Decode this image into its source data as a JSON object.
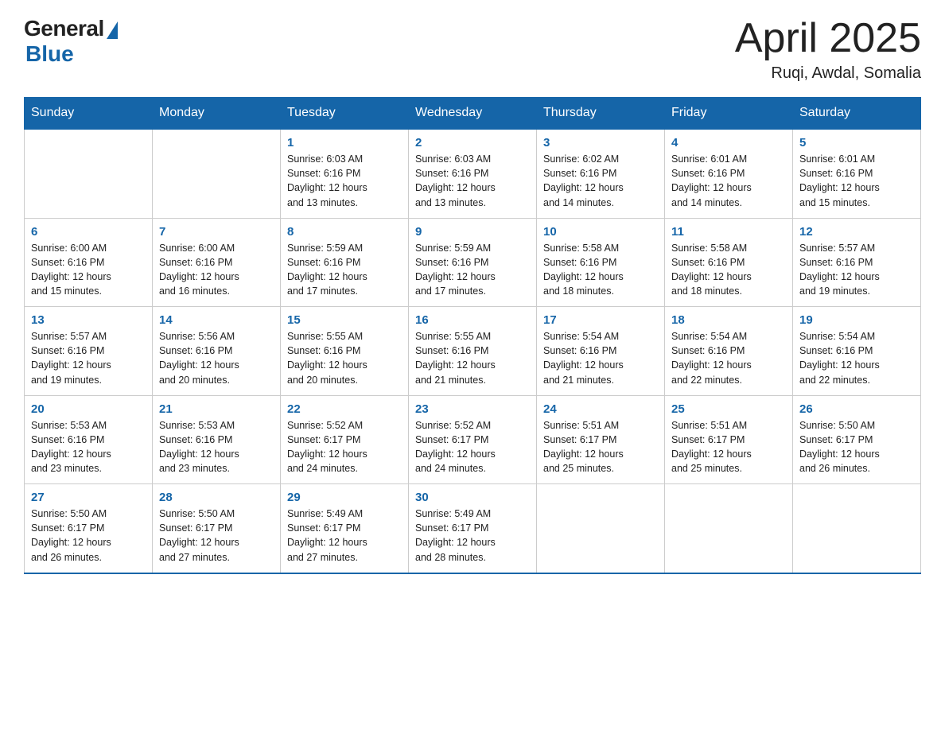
{
  "logo": {
    "general": "General",
    "blue": "Blue"
  },
  "title": "April 2025",
  "location": "Ruqi, Awdal, Somalia",
  "days_of_week": [
    "Sunday",
    "Monday",
    "Tuesday",
    "Wednesday",
    "Thursday",
    "Friday",
    "Saturday"
  ],
  "weeks": [
    [
      {
        "day": "",
        "info": ""
      },
      {
        "day": "",
        "info": ""
      },
      {
        "day": "1",
        "info": "Sunrise: 6:03 AM\nSunset: 6:16 PM\nDaylight: 12 hours\nand 13 minutes."
      },
      {
        "day": "2",
        "info": "Sunrise: 6:03 AM\nSunset: 6:16 PM\nDaylight: 12 hours\nand 13 minutes."
      },
      {
        "day": "3",
        "info": "Sunrise: 6:02 AM\nSunset: 6:16 PM\nDaylight: 12 hours\nand 14 minutes."
      },
      {
        "day": "4",
        "info": "Sunrise: 6:01 AM\nSunset: 6:16 PM\nDaylight: 12 hours\nand 14 minutes."
      },
      {
        "day": "5",
        "info": "Sunrise: 6:01 AM\nSunset: 6:16 PM\nDaylight: 12 hours\nand 15 minutes."
      }
    ],
    [
      {
        "day": "6",
        "info": "Sunrise: 6:00 AM\nSunset: 6:16 PM\nDaylight: 12 hours\nand 15 minutes."
      },
      {
        "day": "7",
        "info": "Sunrise: 6:00 AM\nSunset: 6:16 PM\nDaylight: 12 hours\nand 16 minutes."
      },
      {
        "day": "8",
        "info": "Sunrise: 5:59 AM\nSunset: 6:16 PM\nDaylight: 12 hours\nand 17 minutes."
      },
      {
        "day": "9",
        "info": "Sunrise: 5:59 AM\nSunset: 6:16 PM\nDaylight: 12 hours\nand 17 minutes."
      },
      {
        "day": "10",
        "info": "Sunrise: 5:58 AM\nSunset: 6:16 PM\nDaylight: 12 hours\nand 18 minutes."
      },
      {
        "day": "11",
        "info": "Sunrise: 5:58 AM\nSunset: 6:16 PM\nDaylight: 12 hours\nand 18 minutes."
      },
      {
        "day": "12",
        "info": "Sunrise: 5:57 AM\nSunset: 6:16 PM\nDaylight: 12 hours\nand 19 minutes."
      }
    ],
    [
      {
        "day": "13",
        "info": "Sunrise: 5:57 AM\nSunset: 6:16 PM\nDaylight: 12 hours\nand 19 minutes."
      },
      {
        "day": "14",
        "info": "Sunrise: 5:56 AM\nSunset: 6:16 PM\nDaylight: 12 hours\nand 20 minutes."
      },
      {
        "day": "15",
        "info": "Sunrise: 5:55 AM\nSunset: 6:16 PM\nDaylight: 12 hours\nand 20 minutes."
      },
      {
        "day": "16",
        "info": "Sunrise: 5:55 AM\nSunset: 6:16 PM\nDaylight: 12 hours\nand 21 minutes."
      },
      {
        "day": "17",
        "info": "Sunrise: 5:54 AM\nSunset: 6:16 PM\nDaylight: 12 hours\nand 21 minutes."
      },
      {
        "day": "18",
        "info": "Sunrise: 5:54 AM\nSunset: 6:16 PM\nDaylight: 12 hours\nand 22 minutes."
      },
      {
        "day": "19",
        "info": "Sunrise: 5:54 AM\nSunset: 6:16 PM\nDaylight: 12 hours\nand 22 minutes."
      }
    ],
    [
      {
        "day": "20",
        "info": "Sunrise: 5:53 AM\nSunset: 6:16 PM\nDaylight: 12 hours\nand 23 minutes."
      },
      {
        "day": "21",
        "info": "Sunrise: 5:53 AM\nSunset: 6:16 PM\nDaylight: 12 hours\nand 23 minutes."
      },
      {
        "day": "22",
        "info": "Sunrise: 5:52 AM\nSunset: 6:17 PM\nDaylight: 12 hours\nand 24 minutes."
      },
      {
        "day": "23",
        "info": "Sunrise: 5:52 AM\nSunset: 6:17 PM\nDaylight: 12 hours\nand 24 minutes."
      },
      {
        "day": "24",
        "info": "Sunrise: 5:51 AM\nSunset: 6:17 PM\nDaylight: 12 hours\nand 25 minutes."
      },
      {
        "day": "25",
        "info": "Sunrise: 5:51 AM\nSunset: 6:17 PM\nDaylight: 12 hours\nand 25 minutes."
      },
      {
        "day": "26",
        "info": "Sunrise: 5:50 AM\nSunset: 6:17 PM\nDaylight: 12 hours\nand 26 minutes."
      }
    ],
    [
      {
        "day": "27",
        "info": "Sunrise: 5:50 AM\nSunset: 6:17 PM\nDaylight: 12 hours\nand 26 minutes."
      },
      {
        "day": "28",
        "info": "Sunrise: 5:50 AM\nSunset: 6:17 PM\nDaylight: 12 hours\nand 27 minutes."
      },
      {
        "day": "29",
        "info": "Sunrise: 5:49 AM\nSunset: 6:17 PM\nDaylight: 12 hours\nand 27 minutes."
      },
      {
        "day": "30",
        "info": "Sunrise: 5:49 AM\nSunset: 6:17 PM\nDaylight: 12 hours\nand 28 minutes."
      },
      {
        "day": "",
        "info": ""
      },
      {
        "day": "",
        "info": ""
      },
      {
        "day": "",
        "info": ""
      }
    ]
  ]
}
